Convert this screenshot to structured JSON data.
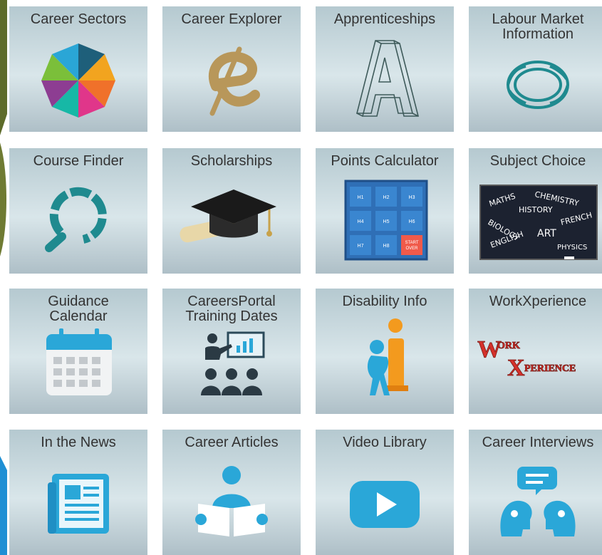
{
  "tiles": [
    {
      "label": "Career Sectors",
      "icon": "color-wheel-icon"
    },
    {
      "label": "Career Explorer",
      "icon": "letter-e-icon"
    },
    {
      "label": "Apprenticeships",
      "icon": "letter-a-wireframe-icon"
    },
    {
      "label": "Labour Market\nInformation",
      "icon": "twisted-ring-icon"
    },
    {
      "label": "Course Finder",
      "icon": "magnifier-ring-icon"
    },
    {
      "label": "Scholarships",
      "icon": "graduation-cap-icon"
    },
    {
      "label": "Points Calculator",
      "icon": "calculator-grid-icon"
    },
    {
      "label": "Subject Choice",
      "icon": "chalkboard-icon"
    },
    {
      "label": "Guidance\nCalendar",
      "icon": "calendar-icon"
    },
    {
      "label": "CareersPortal\nTraining Dates",
      "icon": "presentation-icon"
    },
    {
      "label": "Disability Info",
      "icon": "info-figure-icon"
    },
    {
      "label": "WorkXperience",
      "icon": "workxperience-logo-icon"
    },
    {
      "label": "In the News",
      "icon": "newspaper-icon"
    },
    {
      "label": "Career Articles",
      "icon": "reader-icon"
    },
    {
      "label": "Video Library",
      "icon": "play-button-icon"
    },
    {
      "label": "Career Interviews",
      "icon": "interview-icon"
    }
  ],
  "points_calculator": {
    "keys": [
      "H1",
      "H2",
      "H3",
      "H4",
      "H5",
      "H6",
      "H7",
      "H8"
    ],
    "reset_label": "START\nOVER"
  },
  "subject_board": [
    "MATHS",
    "CHEMISTRY",
    "HISTORY",
    "BIOLOGY",
    "FRENCH",
    "ENGLISH",
    "ART",
    "PHYSICS"
  ],
  "workxperience_logo": {
    "line1_big": "W",
    "line1_small": "ORK",
    "line2_big": "X",
    "line2_small": "PERIENCE"
  },
  "colors": {
    "tile_top": "#b5c9d0",
    "tile_mid": "#d9e6ea",
    "accent_teal": "#1f8a8f",
    "accent_blue": "#2aa7d8",
    "accent_gold": "#b8975a",
    "calc_blue": "#2f6fb6",
    "calc_red": "#f05a4a"
  }
}
